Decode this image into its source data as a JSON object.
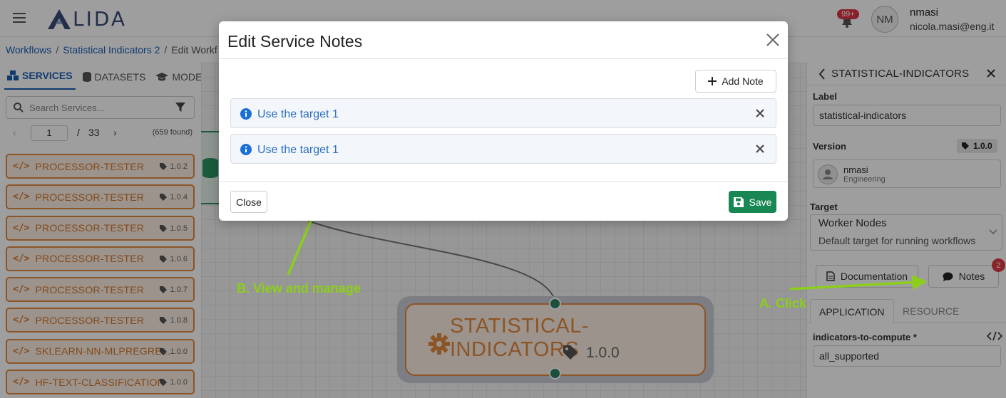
{
  "header": {
    "logo_text": "LIDA",
    "notifications_count": "99+",
    "user_initials": "NM",
    "user_name": "nmasi",
    "user_email": "nicola.masi@eng.it"
  },
  "breadcrumb": [
    "Workflows",
    "Statistical Indicators 2",
    "Edit Workf"
  ],
  "left_tabs": [
    "SERVICES",
    "DATASETS",
    "MODELS"
  ],
  "search": {
    "placeholder": "Search Services..."
  },
  "pager": {
    "page": "1",
    "slash": "/",
    "total": "33",
    "found": "(659 found)"
  },
  "services": [
    {
      "name": "PROCESSOR-TESTER",
      "version": "1.0.2"
    },
    {
      "name": "PROCESSOR-TESTER",
      "version": "1.0.4"
    },
    {
      "name": "PROCESSOR-TESTER",
      "version": "1.0.5"
    },
    {
      "name": "PROCESSOR-TESTER",
      "version": "1.0.6"
    },
    {
      "name": "PROCESSOR-TESTER",
      "version": "1.0.7"
    },
    {
      "name": "PROCESSOR-TESTER",
      "version": "1.0.8"
    },
    {
      "name": "SKLEARN-NN-MLPREGRE...",
      "version": "1.0.0"
    },
    {
      "name": "HF-TEXT-CLASSIFICATION",
      "version": "1.0.0"
    }
  ],
  "canvas_node": {
    "title": "STATISTICAL-INDICATORS",
    "version": "1.0.0"
  },
  "right_panel": {
    "title": "STATISTICAL-INDICATORS",
    "label_label": "Label",
    "label_value": "statistical-indicators",
    "version_label": "Version",
    "version_value": "1.0.0",
    "owner_name": "nmasi",
    "owner_dept": "Engineering",
    "target_label": "Target",
    "target_name": "Worker Nodes",
    "target_desc": "Default target for running workflows",
    "documentation_btn": "Documentation",
    "notes_btn": "Notes",
    "notes_count": "2",
    "tabs": [
      "APPLICATION",
      "RESOURCE"
    ],
    "param_label": "indicators-to-compute *",
    "param_value": "all_supported"
  },
  "annotations": {
    "a": "A. Click",
    "b": "B. View and manage"
  },
  "modal": {
    "title": "Edit Service Notes",
    "add_note": "Add Note",
    "notes": [
      "Use the target 1",
      "Use the target 1"
    ],
    "close": "Close",
    "save": "Save"
  },
  "colors": {
    "accent": "#1a5fb4",
    "service_orange": "#e3893f",
    "save_green": "#198754",
    "annotation_green": "#8ccf1a"
  }
}
